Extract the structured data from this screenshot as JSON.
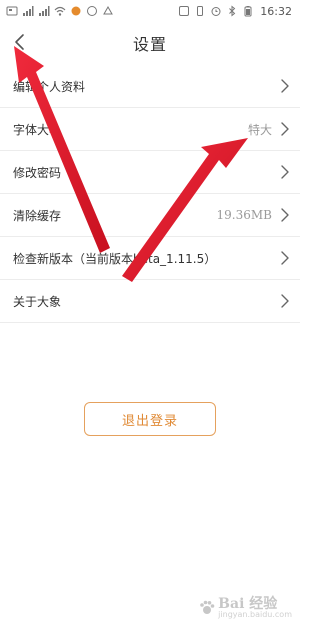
{
  "status_bar": {
    "time": "16:32"
  },
  "header": {
    "title": "设置"
  },
  "settings": {
    "items": [
      {
        "label": "编辑个人资料",
        "value": ""
      },
      {
        "label": "字体大小",
        "value": "特大"
      },
      {
        "label": "修改密码",
        "value": ""
      },
      {
        "label": "清除缓存",
        "value": "19.36MB"
      },
      {
        "label": "检查新版本（当前版本beta_1.11.5）",
        "value": ""
      },
      {
        "label": "关于大象",
        "value": ""
      }
    ]
  },
  "logout": {
    "label": "退出登录"
  },
  "watermark": {
    "text": "Bai 经验",
    "sub": "jingyan.baidu.com"
  },
  "colors": {
    "accent": "#e08a35",
    "annotation_arrow": "#e8182d",
    "text_primary": "#333333",
    "text_secondary": "#9a9a9a",
    "divider": "#ececec"
  },
  "icons": {
    "back": "chevron-left-icon",
    "row_chevron": "chevron-right-icon"
  }
}
